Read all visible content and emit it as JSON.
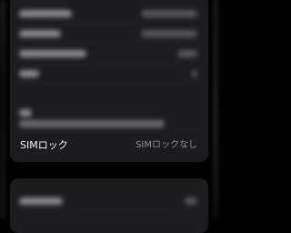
{
  "settings": {
    "sim_lock": {
      "label": "SIMロック",
      "value": "SIMロックなし"
    }
  },
  "colors": {
    "background": "#000000",
    "group_background": "#1c1c1e",
    "primary_text": "#f2f2f7",
    "secondary_text": "#8e8e93",
    "separator": "#2c2c2e"
  }
}
